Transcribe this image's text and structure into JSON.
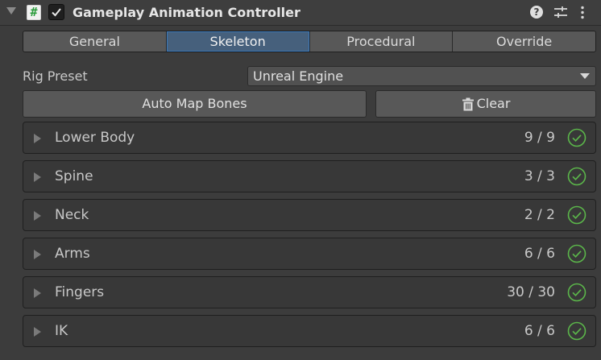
{
  "header": {
    "title": "Gameplay Animation Controller",
    "script_glyph": "#",
    "help_glyph": "?",
    "enabled": true,
    "icons": [
      "foldout-arrow-icon",
      "script-icon",
      "checkbox-icon",
      "help-icon",
      "preset-icon",
      "kebab-menu-icon"
    ]
  },
  "tabs": [
    {
      "label": "General",
      "active": false
    },
    {
      "label": "Skeleton",
      "active": true
    },
    {
      "label": "Procedural",
      "active": false
    },
    {
      "label": "Override",
      "active": false
    }
  ],
  "rig_preset": {
    "label": "Rig Preset",
    "value": "Unreal Engine"
  },
  "buttons": {
    "auto_map": "Auto Map Bones",
    "clear": "Clear"
  },
  "sections": [
    {
      "name": "Lower Body",
      "count": "9 / 9",
      "status": "complete"
    },
    {
      "name": "Spine",
      "count": "3 / 3",
      "status": "complete"
    },
    {
      "name": "Neck",
      "count": "2 / 2",
      "status": "complete"
    },
    {
      "name": "Arms",
      "count": "6 / 6",
      "status": "complete"
    },
    {
      "name": "Fingers",
      "count": "30 / 30",
      "status": "complete"
    },
    {
      "name": "IK",
      "count": "6 / 6",
      "status": "complete"
    }
  ],
  "colors": {
    "background": "#3c3c3c",
    "active_tab": "#46607c",
    "active_tab_border": "#3a79bb",
    "check_green": "#5bb64a",
    "script_green": "#2d9d3e"
  }
}
